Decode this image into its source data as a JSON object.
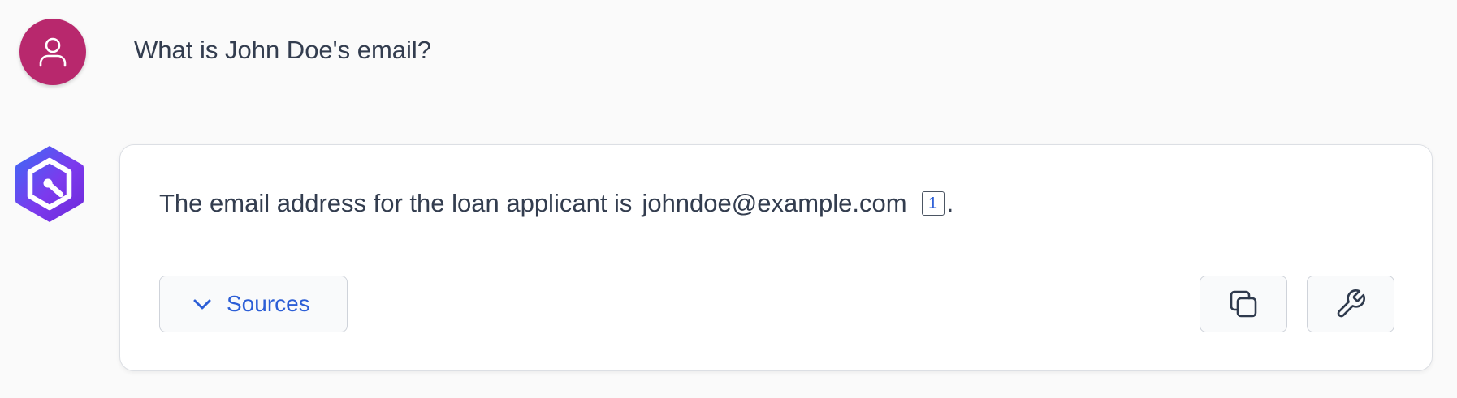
{
  "user": {
    "avatar_icon": "user-icon",
    "avatar_color": "#b8286d",
    "question": "What is John Doe's email?"
  },
  "assistant": {
    "logo_icon": "hexagon-logo-icon",
    "answer_prefix": "The email address for the loan applicant is",
    "answer_email": "johndoe@example.com",
    "citation": "1",
    "answer_suffix": ".",
    "sources_label": "Sources",
    "sources_icon": "chevron-down-icon",
    "copy_icon": "copy-icon",
    "tools_icon": "wrench-icon",
    "accent_color": "#2c5ed6"
  }
}
